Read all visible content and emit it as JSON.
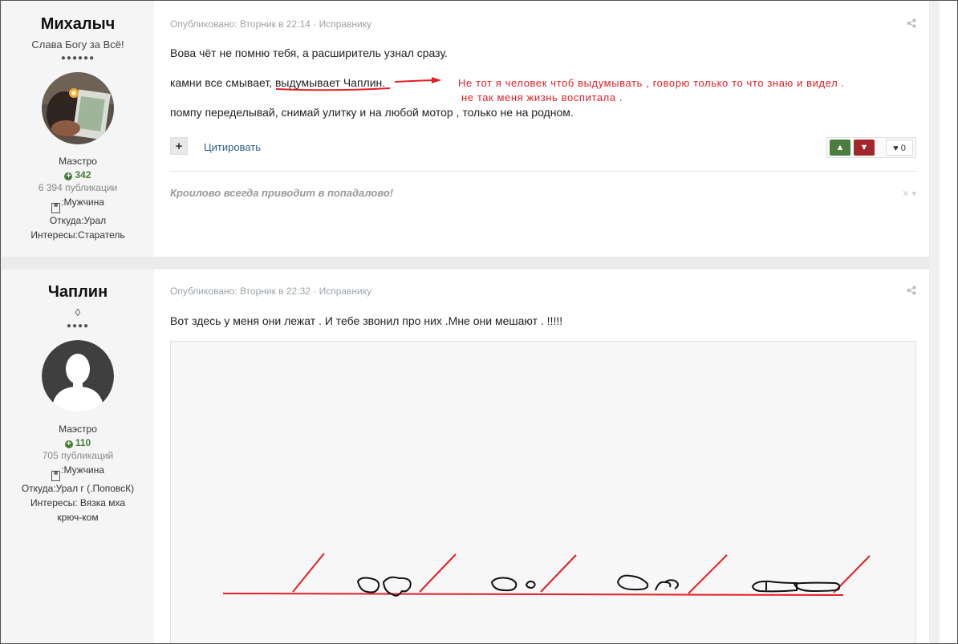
{
  "posts": [
    {
      "author": {
        "name": "Михалыч",
        "title": "Слава Богу за Всё!",
        "pips": "●●●●●●",
        "rank": "Маэстро",
        "reputation": "342",
        "posts_count": "6 394 публикации",
        "gender": ":Мужчина",
        "from": "Откуда:Урал",
        "interests": "Интересы:Старатель"
      },
      "meta": {
        "published": "Опубликовано: Вторник в 22:14",
        "editor_link": " · Исправнику"
      },
      "content": {
        "line1": "Вова чёт не помню тебя, а расширитель узнал сразу.",
        "line2": "камни все смывает, выдумывает Чаплин.",
        "line3": "помпу переделывай, снимай улитку и на любой мотор , только не на родном."
      },
      "annotation": {
        "line1": "Не тот я человек чтоб выдумывать , говорю только то что знаю и видел .",
        "line2": "не так меня жизнь воспитала ."
      },
      "actions": {
        "plus": "+",
        "quote": "Цитировать",
        "like_count": "0"
      },
      "signature": "Кроилово всегда приводит в попадалово!"
    },
    {
      "author": {
        "name": "Чаплин",
        "title": "◊",
        "pips": "●●●●",
        "rank": "Маэстро",
        "reputation": "110",
        "posts_count": "705 публикаций",
        "gender": ":Мужчина",
        "from": "Откуда:Урал г (.ПоповсК)",
        "interests": "Интересы: Вязка мха крюч-ком"
      },
      "meta": {
        "published": "Опубликовано: Вторник в 22:32",
        "editor_link": " · Исправнику"
      },
      "content": {
        "line1": "Вот здесь у меня они лежат . И тебе звонил про них .Мне они мешают . !!!!!"
      }
    }
  ],
  "icons": {
    "share": "share-icon",
    "reputation": "plus-circle-icon",
    "gender": "gender-icon",
    "vote_up": "arrow-up-icon",
    "vote_down": "arrow-down-icon",
    "like": "heart-icon"
  },
  "colors": {
    "annotation_red": "#e31e24",
    "vote_up": "#4b7d3e",
    "vote_down": "#a3262d",
    "link": "#2e5f8a"
  }
}
